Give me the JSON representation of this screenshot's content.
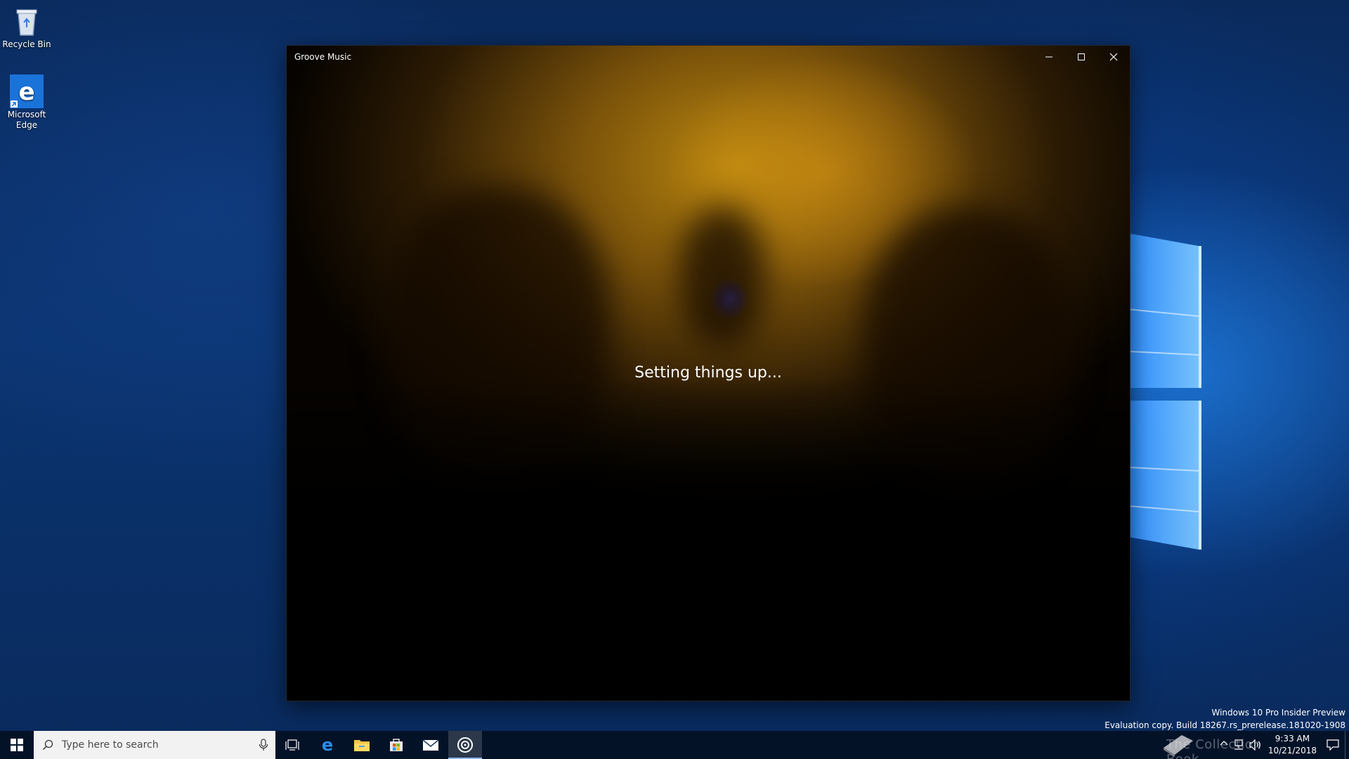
{
  "desktop": {
    "icons": [
      {
        "label": "Recycle Bin",
        "icon": "recycle-bin-icon"
      },
      {
        "label": "Microsoft Edge",
        "icon": "edge-icon"
      }
    ]
  },
  "window": {
    "title": "Groove Music",
    "status": "Setting things up...",
    "caption_buttons": [
      "minimize-icon",
      "maximize-icon",
      "close-icon"
    ]
  },
  "watermark": {
    "line1": "Windows 10 Pro Insider Preview",
    "line2": "Evaluation copy. Build 18267.rs_prerelease.181020-1908"
  },
  "taskbar": {
    "search_placeholder": "Type here to search",
    "pinned": [
      "task-view-icon",
      "edge-icon",
      "file-explorer-icon",
      "store-icon",
      "mail-icon",
      "groove-music-icon"
    ],
    "active_app": "Groove Music",
    "tray_logo_text": "The Collection Book",
    "clock": {
      "time": "9:33 AM",
      "date": "10/21/2018"
    }
  },
  "colors": {
    "desktop_blue": "#0b3470",
    "taskbar": "#041024",
    "accent": "#8fb6ff",
    "window_gold": "#b8860f"
  }
}
